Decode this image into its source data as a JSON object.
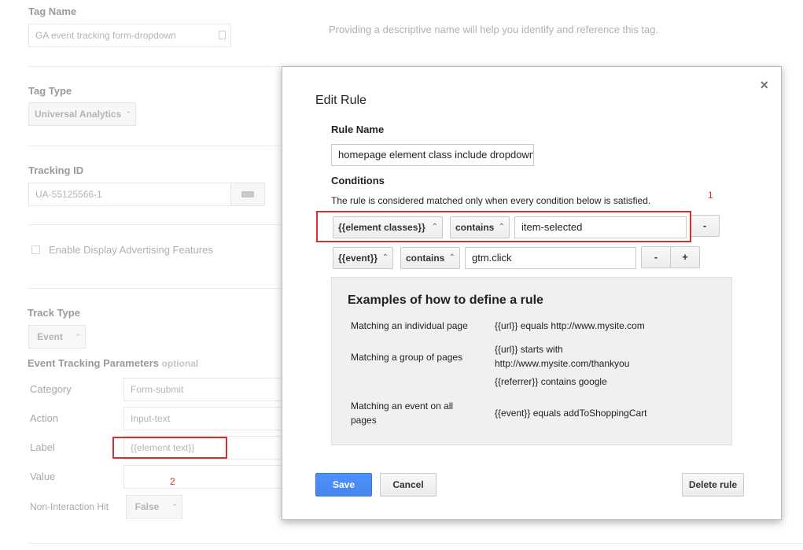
{
  "background": {
    "tag_name_label": "Tag Name",
    "tag_name_value": "GA event tracking form-dropdown",
    "tag_name_hint": "Providing a descriptive name will help you identify and reference this tag.",
    "tag_type_label": "Tag Type",
    "tag_type_value": "Universal Analytics",
    "tracking_id_label": "Tracking ID",
    "tracking_id_value": "UA-55125566-1",
    "display_adv_label": "Enable Display Advertising Features",
    "track_type_label": "Track Type",
    "track_type_value": "Event",
    "etp_label": "Event Tracking Parameters",
    "etp_optional": "optional",
    "category_label": "Category",
    "category_value": "Form-submit",
    "action_label": "Action",
    "action_value": "Input-text",
    "label_label": "Label",
    "label_value": "{{element text}}",
    "value_label": "Value",
    "non_interaction_label": "Non-Interaction Hit",
    "non_interaction_value": "False",
    "annotation_2": "2"
  },
  "dialog": {
    "title": "Edit Rule",
    "close": "×",
    "rule_name_heading": "Rule Name",
    "rule_name_value": "homepage element class include dropdown",
    "conditions_heading": "Conditions",
    "conditions_desc": "The rule is considered matched only when every condition below is satisfied.",
    "annotation_1": "1",
    "conditions": [
      {
        "variable": "{{element classes}}",
        "operator": "contains",
        "value": "item-selected",
        "remove": "-"
      },
      {
        "variable": "{{event}}",
        "operator": "contains",
        "value": "gtm.click",
        "remove": "-",
        "add": "+"
      }
    ],
    "examples": {
      "title": "Examples of how to define a rule",
      "rows": [
        {
          "label": "Matching an individual page",
          "value": "{{url}} equals http://www.mysite.com"
        },
        {
          "label": "Matching a group of pages",
          "value": "{{url}} starts with http://www.mysite.com/thankyou",
          "value2": "{{referrer}} contains google"
        },
        {
          "label": "Matching an event on all pages",
          "value": "{{event}} equals addToShoppingCart"
        }
      ]
    },
    "save_label": "Save",
    "cancel_label": "Cancel",
    "delete_label": "Delete rule"
  }
}
